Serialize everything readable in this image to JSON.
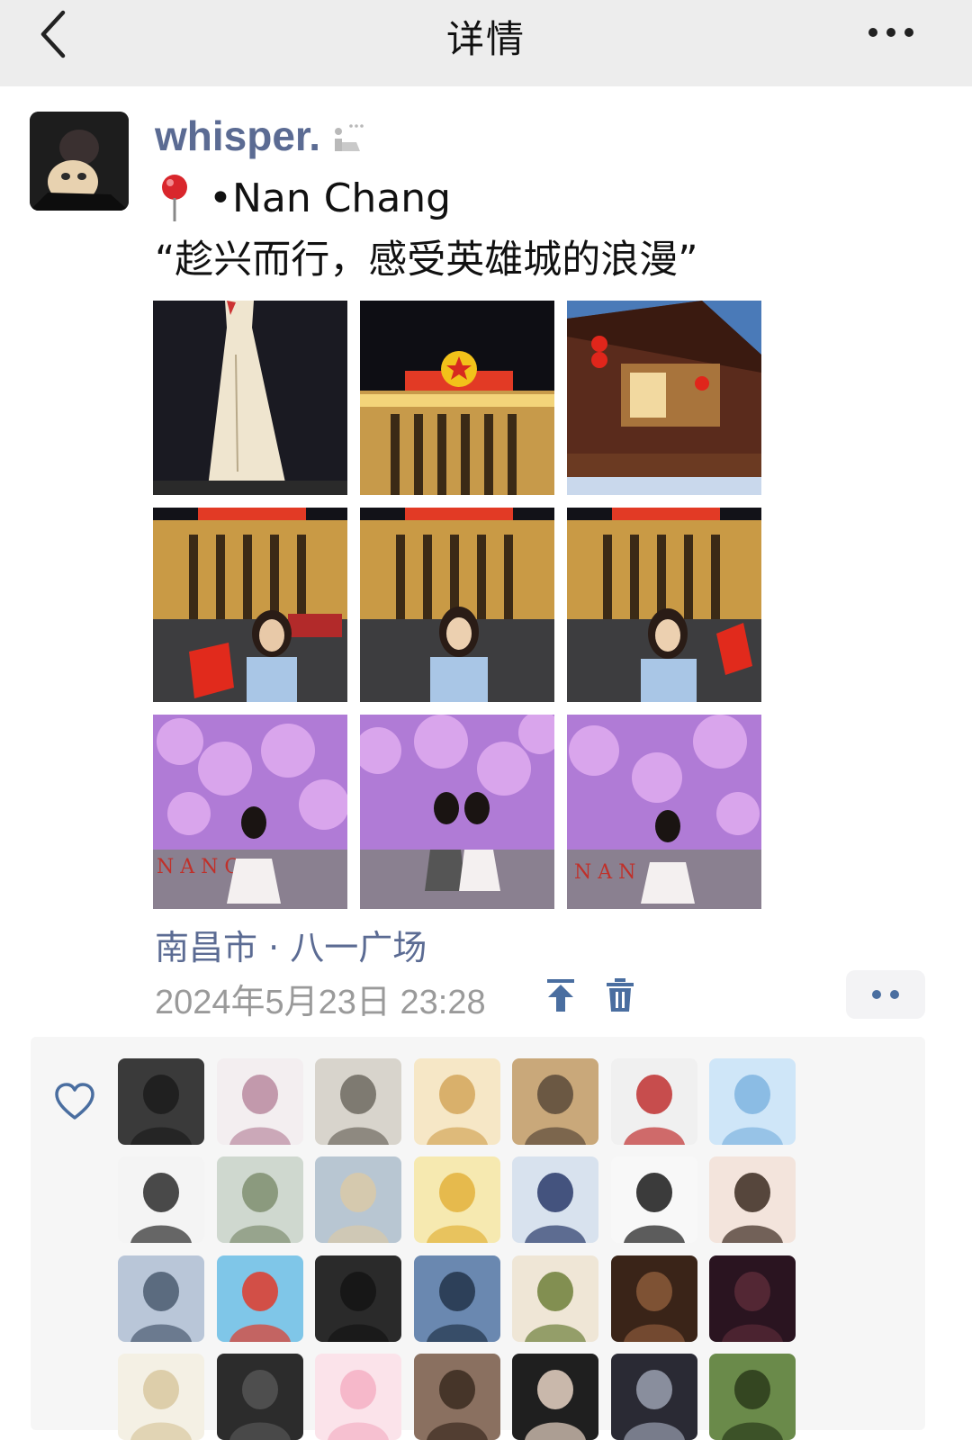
{
  "header": {
    "title": "详情"
  },
  "post": {
    "username": "whisper.",
    "location_line": "•Nan Chang",
    "caption": "“趁兴而行，感受英雄城的浪漫”",
    "photos": [
      "monument-night",
      "hall-night",
      "pavilion-lanterns",
      "hall-girl-flag",
      "hall-girl",
      "hall-girl-peace-sign",
      "flower-wall-girl",
      "flower-wall-two-girls",
      "flower-wall-girl-2"
    ],
    "place": "南昌市 · 八一广场",
    "timestamp": "2024年5月23日 23:28"
  },
  "likes": {
    "icon": "heart-icon",
    "avatar_count": 28
  },
  "colors": {
    "header_bg": "#ededed",
    "name_blue": "#5b6b93",
    "time_gray": "#9a9a9a",
    "likes_bg": "#f6f6f6"
  }
}
